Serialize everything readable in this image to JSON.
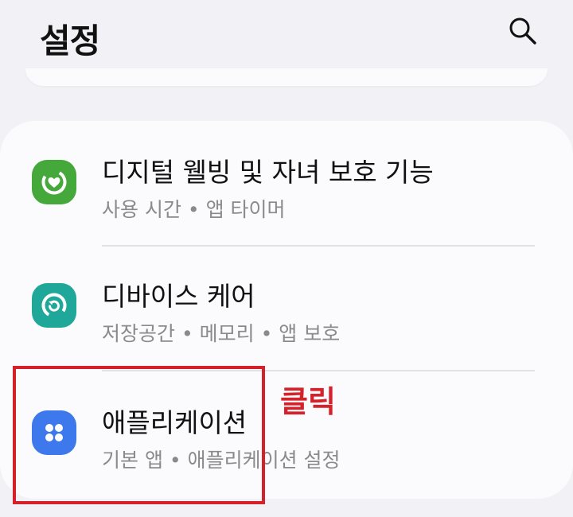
{
  "header": {
    "title": "설정",
    "search_icon": "search-icon"
  },
  "settings": {
    "items": [
      {
        "title": "디지털 웰빙 및 자녀 보호 기능",
        "subtitle": "사용 시간 • 앱 타이머",
        "icon": "digital-wellbeing-icon",
        "icon_color": "#45a83b"
      },
      {
        "title": "디바이스 케어",
        "subtitle": "저장공간 • 메모리 • 앱 보호",
        "icon": "device-care-icon",
        "icon_color": "#1fa89a"
      },
      {
        "title": "애플리케이션",
        "subtitle": "기본 앱 • 애플리케이션 설정",
        "icon": "apps-icon",
        "icon_color": "#3d78ec"
      }
    ]
  },
  "annotation": {
    "click_label": "클릭",
    "color": "#d4212a"
  }
}
